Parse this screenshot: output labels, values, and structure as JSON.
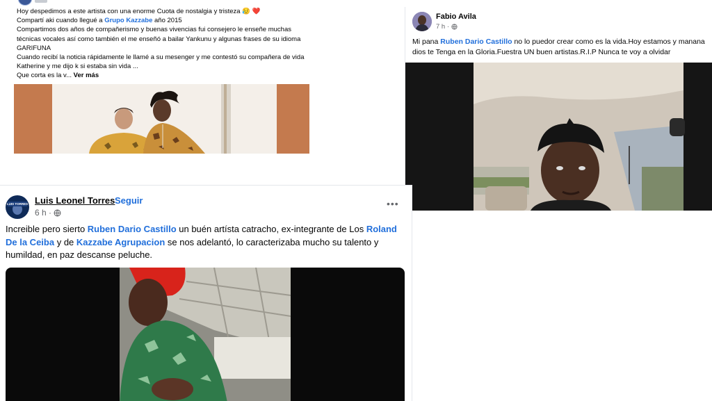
{
  "post1": {
    "lines": [
      "Hoy despedimos a este artista con una enorme Cuota de nostalgia y tristeza 😥 ❤️",
      "Compartí aki cuando llegué a ",
      "Compartimos dos años de compañerismo y buenas vivencias fui consejero le enseñe muchas",
      "técnicas vocales así como también el me enseñó a bailar Yankunu y algunas frases de su idioma",
      "GARIFUNA",
      "Cuando recibí la noticia rápidamente le llamé a su mesenger y me contestó su compañera de vida",
      "Katherine y me dijo k si estaba sin vida ...",
      "Que corta es la v... "
    ],
    "group_link": "Grupo Kazzabe",
    "group_suffix": " año 2015",
    "see_more": "Ver más"
  },
  "post2": {
    "author": "Fabio Avila",
    "time": "7 h ·",
    "text_before": "Mi pana ",
    "mention": "Ruben Dario Castillo",
    "text_after": " no lo puedor crear como es la vida.Hoy estamos y manana dios te Tenga en la Gloria.Fuestra UN buen artistas.R.I.P Nunca te voy a olvidar"
  },
  "post3": {
    "author": "Luis Leonel Torres",
    "follow": "Seguir",
    "time": "6 h ·",
    "more": "•••",
    "t1": "Increible pero sierto ",
    "m1": "Ruben Dario Castillo",
    "t2": " un buén artísta catracho, ex-integrante de Los ",
    "m2": "Roland De la Ceiba",
    "t3": "  y de ",
    "m3": "Kazzabe Agrupacion",
    "t4": " se nos adelantó, lo caracterizaba mucho su talento y humildad, en paz descanse peluche.",
    "avatar_text": "LUIS TORRES"
  },
  "colors": {
    "link": "#216fdb",
    "meta": "#65676b"
  }
}
